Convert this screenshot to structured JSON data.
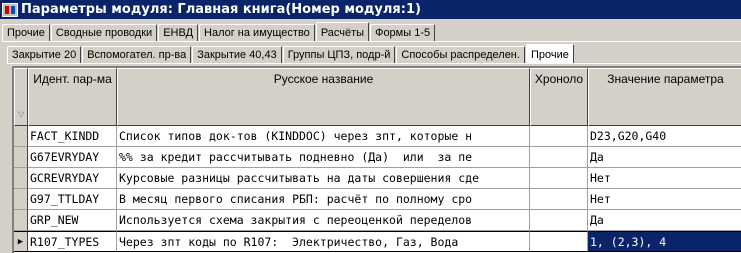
{
  "window": {
    "title": "Параметры модуля: Главная книга(Номер модуля:1)"
  },
  "tabs": [
    {
      "label": "Прочие"
    },
    {
      "label": "Сводные проводки"
    },
    {
      "label": "ЕНВД"
    },
    {
      "label": "Налог на имущество"
    },
    {
      "label": "Расчёты"
    },
    {
      "label": "Формы 1-5"
    }
  ],
  "subtabs": [
    {
      "label": "Закрытие 20"
    },
    {
      "label": "Вспомогател. пр-ва"
    },
    {
      "label": "Закрытие 40,43"
    },
    {
      "label": "Группы ЦПЗ, подр-й"
    },
    {
      "label": "Способы распределен."
    },
    {
      "label": "Прочие"
    }
  ],
  "grid": {
    "columns": [
      "Идент. пар-ма",
      "Русское название",
      "Хроноло",
      "Значение параметра"
    ],
    "rows": [
      {
        "id": "FACT_KINDD",
        "name": "Список типов док-тов (KINDDOC) через зпт, которые н",
        "chrono": "",
        "value": "D23,G20,G40"
      },
      {
        "id": "G67EVRYDAY",
        "name": "%% за кредит рассчитывать подневно (Да)  или  за пе",
        "chrono": "",
        "value": "Да"
      },
      {
        "id": "GCREVRYDAY",
        "name": "Курсовые разницы рассчитывать на даты совершения сде",
        "chrono": "",
        "value": "Нет"
      },
      {
        "id": "G97_TTLDAY",
        "name": "В месяц первого списания РБП: расчёт по полному сро",
        "chrono": "",
        "value": "Нет"
      },
      {
        "id": "GRP_NEW",
        "name": "Используется схема закрытия с переоценкой переделов",
        "chrono": "",
        "value": "Да"
      },
      {
        "id": "R107_TYPES",
        "name": "Через зпт коды по R107:  Электричество, Газ, Вода",
        "chrono": "",
        "value": "1, (2,3), 4"
      }
    ]
  },
  "icons": {
    "app": "app-icon",
    "row_pointer": "row-pointer-icon",
    "sort": "sort-indicator-icon"
  },
  "colors": {
    "titlebar": "#0a246a",
    "selection": "#0a246a",
    "face": "#d4d0c8"
  }
}
